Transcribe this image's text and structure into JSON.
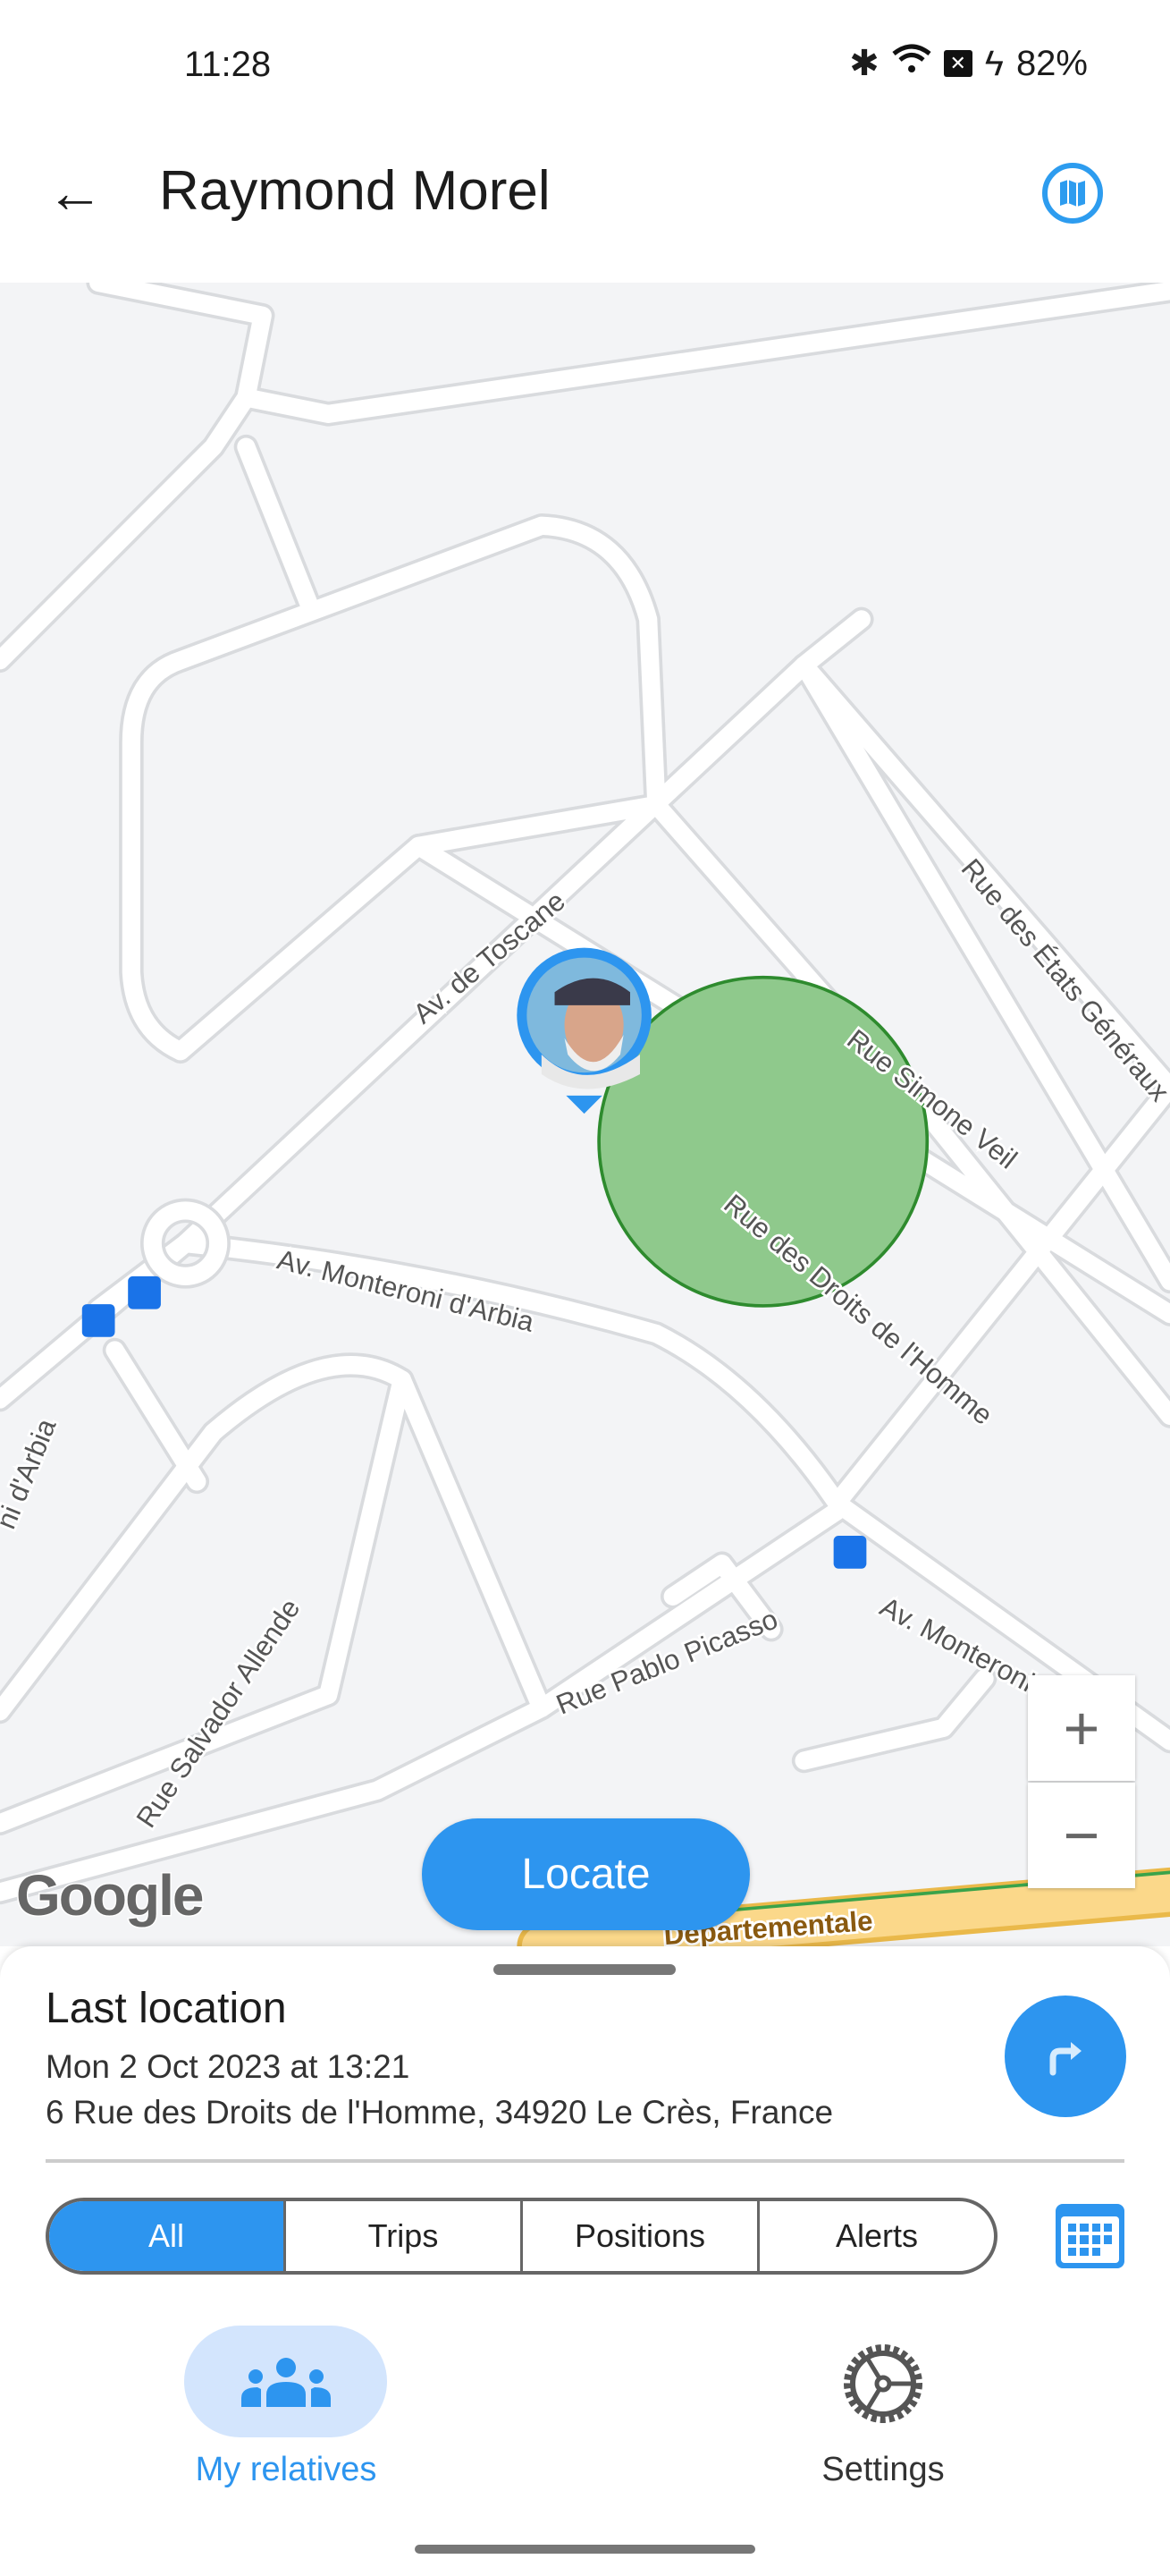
{
  "status_bar": {
    "time": "11:28",
    "battery": "82%",
    "icons": [
      "bluetooth-icon",
      "wifi-icon",
      "sim-off-icon",
      "charging-icon"
    ]
  },
  "header": {
    "title": "Raymond Morel",
    "back_icon": "arrow-left-icon",
    "map_icon": "map-icon"
  },
  "map": {
    "labels": [
      "Av. de Toscane",
      "Rue Simone Veil",
      "Rue des Droits de l'Homme",
      "Rue des États Généraux",
      "Av. Monteroni d'Arbia",
      "ni d'Arbia",
      "Rue Salvador Allende",
      "Rue Pablo Picasso",
      "Av. Monteroni d'Arbia",
      "Departementale"
    ],
    "zoom_in": "+",
    "zoom_out": "−",
    "attribution": "Google",
    "locate_label": "Locate",
    "colors": {
      "geofence": "#8fc98c",
      "geofence_border": "#2e8b2e",
      "accent": "#2d95ef"
    }
  },
  "sheet": {
    "title": "Last location",
    "date": "Mon 2 Oct 2023 at 13:21",
    "address": "6 Rue des Droits de l'Homme, 34920 Le Crès, France",
    "directions_icon": "turn-right-icon",
    "filters": [
      {
        "label": "All",
        "selected": true
      },
      {
        "label": "Trips"
      },
      {
        "label": "Positions"
      },
      {
        "label": "Alerts"
      }
    ],
    "calendar_icon": "calendar-icon"
  },
  "bottom_nav": [
    {
      "label": "My relatives",
      "icon": "group-icon",
      "active": true
    },
    {
      "label": "Settings",
      "icon": "settings-gear-icon"
    }
  ]
}
